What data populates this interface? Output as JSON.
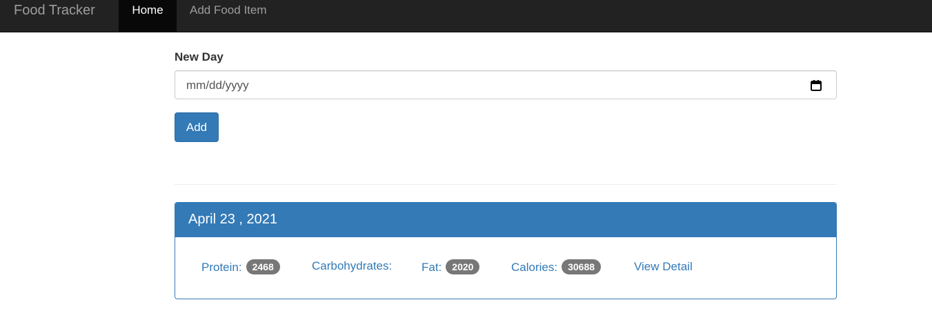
{
  "navbar": {
    "brand": "Food Tracker",
    "nav_items": [
      {
        "label": "Home",
        "active": true
      },
      {
        "label": "Add Food Item",
        "active": false
      }
    ]
  },
  "form": {
    "label": "New Day",
    "date_placeholder": "mm/dd/yyyy",
    "date_icon": "calendar-icon",
    "add_label": "Add"
  },
  "days": [
    {
      "date": "April 23 , 2021",
      "protein_label": "Protein:",
      "protein": "2468",
      "carbs_label": "Carbohydrates:",
      "fat_label": "Fat:",
      "fat": "2020",
      "calories_label": "Calories:",
      "calories": "30688",
      "detail_label": "View Detail"
    }
  ],
  "colors": {
    "navbar_bg": "#222222",
    "primary": "#337ab7",
    "badge_bg": "#777777"
  }
}
